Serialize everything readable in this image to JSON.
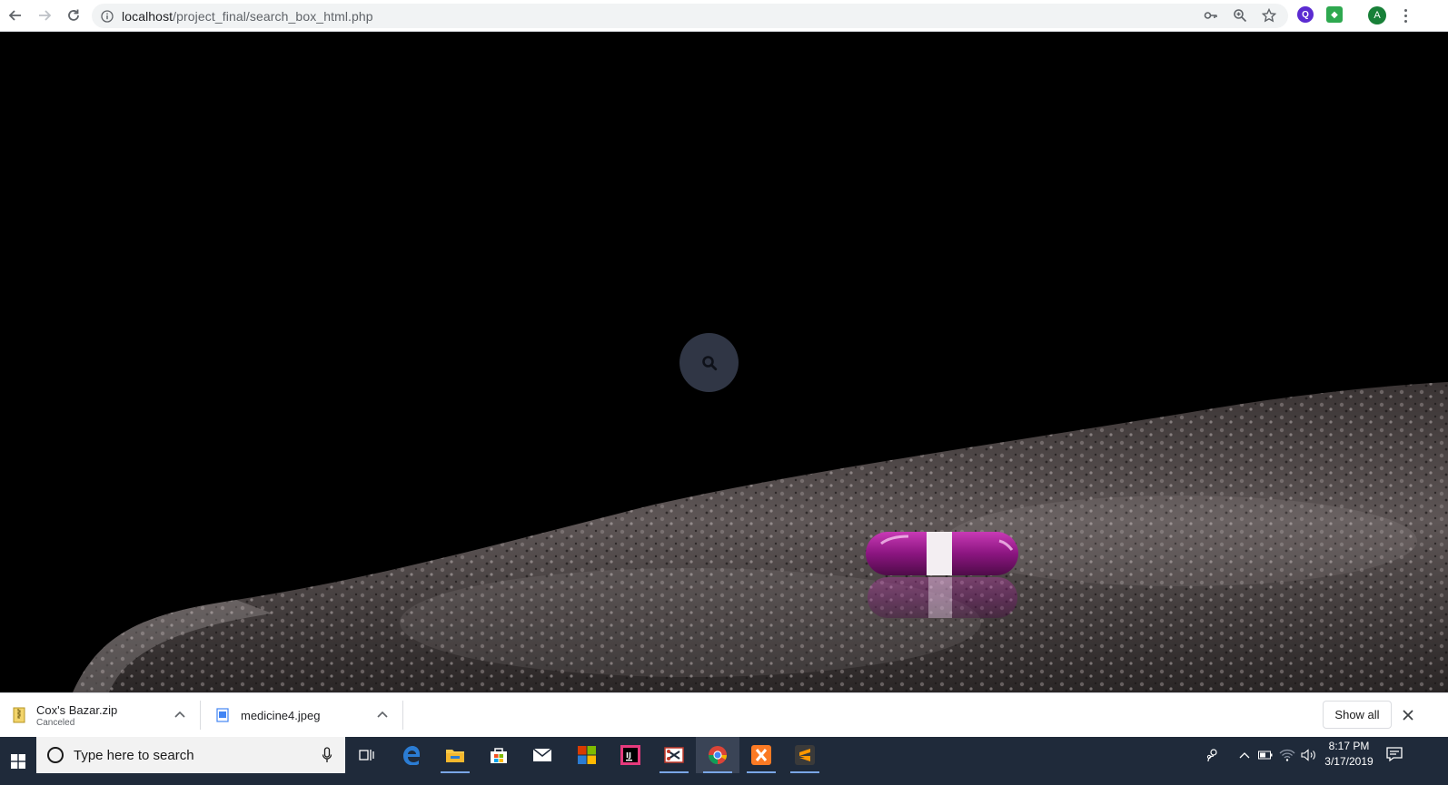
{
  "browser": {
    "url_host": "localhost",
    "url_path": "/project_final/search_box_html.php",
    "profile_initial": "A"
  },
  "page": {
    "search_button": "search"
  },
  "downloads": {
    "items": [
      {
        "name": "Cox's Bazar.zip",
        "status": "Canceled"
      },
      {
        "name": "medicine4.jpeg",
        "status": ""
      }
    ],
    "show_all_label": "Show all"
  },
  "taskbar": {
    "search_placeholder": "Type here to search",
    "clock_time": "8:17 PM",
    "clock_date": "3/17/2019"
  },
  "colors": {
    "search_circle": "#303645",
    "capsule": "#9a1d8c",
    "taskbar": "#1f2a3a"
  }
}
